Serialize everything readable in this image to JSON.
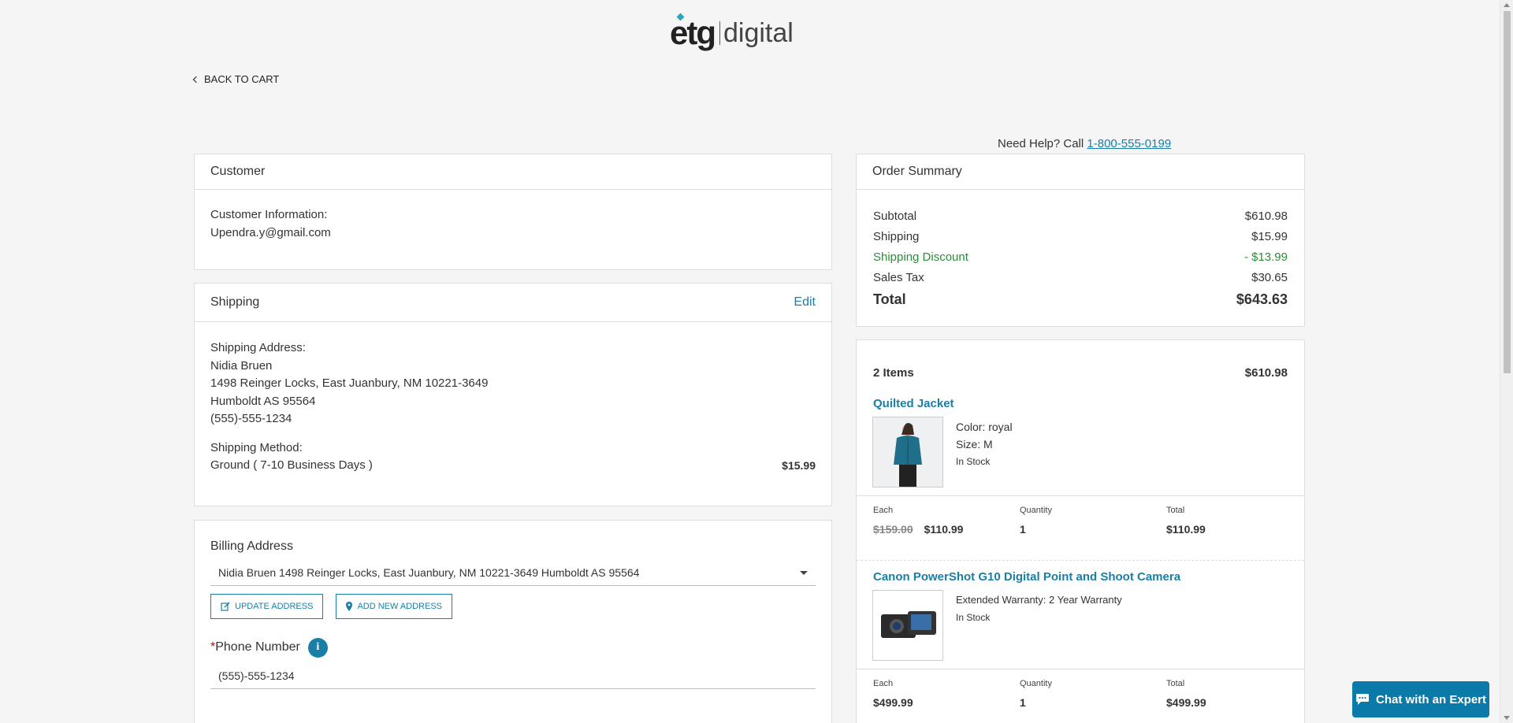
{
  "header": {
    "logo_text": "etg|digital",
    "back_link": "BACK TO CART"
  },
  "help": {
    "prefix": "Need Help? Call",
    "phone": "1-800-555-0199"
  },
  "customer": {
    "title": "Customer",
    "info_label": "Customer Information:",
    "email": "Upendra.y@gmail.com"
  },
  "shipping": {
    "title": "Shipping",
    "edit_label": "Edit",
    "address_label": "Shipping Address:",
    "name": "Nidia Bruen",
    "street": "1498 Reinger Locks, East Juanbury, NM 10221-3649",
    "city_line": "Humboldt AS 95564",
    "phone": "(555)-555-1234",
    "method_label": "Shipping Method:",
    "method": "Ground ( 7-10 Business Days )",
    "method_price": "$15.99"
  },
  "billing": {
    "title": "Billing Address",
    "selected_address": "Nidia Bruen 1498 Reinger Locks, East Juanbury, NM 10221-3649 Humboldt AS 95564",
    "update_button": "UPDATE ADDRESS",
    "add_button": "ADD NEW ADDRESS",
    "phone_required_mark": "*",
    "phone_label": "Phone Number",
    "phone_info_icon": "i",
    "phone_value": "(555)-555-1234"
  },
  "summary": {
    "title": "Order Summary",
    "rows": [
      {
        "label": "Subtotal",
        "value": "$610.98"
      },
      {
        "label": "Shipping",
        "value": "$15.99"
      },
      {
        "label": "Shipping Discount",
        "value": "- $13.99"
      },
      {
        "label": "Sales Tax",
        "value": "$30.65"
      }
    ],
    "total_label": "Total",
    "total_value": "$643.63",
    "discount_color": "#2e8b3a"
  },
  "items": {
    "count_label": "2 Items",
    "count_total": "$610.98",
    "list": [
      {
        "name": "Quilted Jacket",
        "attr1": "Color: royal",
        "attr2": "Size: M",
        "stock": "In Stock",
        "each_label": "Each",
        "original_price": "$159.00",
        "price": "$110.99",
        "qty_label": "Quantity",
        "qty": "1",
        "total_label": "Total",
        "total": "$110.99"
      },
      {
        "name": "Canon PowerShot G10 Digital Point and Shoot Camera",
        "attr1": "Extended Warranty: 2 Year Warranty",
        "stock": "In Stock",
        "each_label": "Each",
        "price": "$499.99",
        "qty_label": "Quantity",
        "qty": "1",
        "total_label": "Total",
        "total": "$499.99"
      }
    ]
  },
  "chat": {
    "label": "Chat with an Expert",
    "icon": "chat-bubble-icon"
  },
  "colors": {
    "accent": "#1a7fa6",
    "chat_bg": "#0b7aa8",
    "page_bg": "#f5f5f5"
  }
}
